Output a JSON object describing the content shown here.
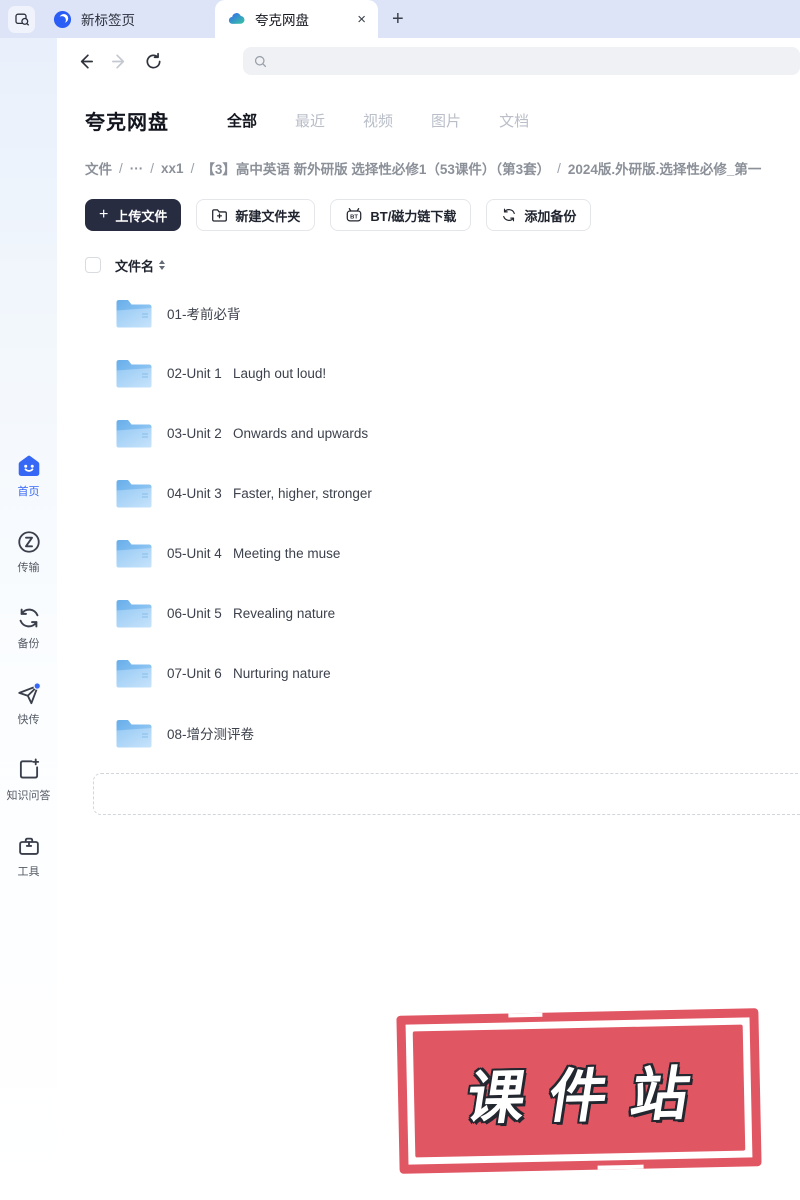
{
  "tabbar": {
    "tabs": [
      {
        "label": "新标签页"
      },
      {
        "label": "夸克网盘"
      }
    ],
    "close_glyph": "×",
    "new_tab_glyph": "+"
  },
  "page": {
    "title": "夸克网盘",
    "filter_tabs": [
      {
        "label": "全部",
        "active": true
      },
      {
        "label": "最近",
        "active": false
      },
      {
        "label": "视频",
        "active": false
      },
      {
        "label": "图片",
        "active": false
      },
      {
        "label": "文档",
        "active": false
      }
    ]
  },
  "breadcrumb": {
    "separator": "/",
    "items": [
      "文件",
      "···",
      "xx1",
      "【3】高中英语 新外研版 选择性必修1（53课件）（第3套）",
      "2024版.外研版.选择性必修_第一"
    ]
  },
  "toolbar": {
    "upload": "上传文件",
    "upload_plus": "+",
    "new_folder": "新建文件夹",
    "bt_download": "BT/磁力链下载",
    "add_backup": "添加备份"
  },
  "files": {
    "name_header": "文件名",
    "rows": [
      {
        "name": "01-考前必背"
      },
      {
        "name": "02-Unit 1   Laugh out loud!"
      },
      {
        "name": "03-Unit 2   Onwards and upwards"
      },
      {
        "name": "04-Unit 3   Faster, higher, stronger"
      },
      {
        "name": "05-Unit 4   Meeting the muse"
      },
      {
        "name": "06-Unit 5   Revealing nature"
      },
      {
        "name": "07-Unit 6   Nurturing nature"
      },
      {
        "name": "08-增分测评卷"
      }
    ]
  },
  "sidebar": {
    "items": [
      {
        "label": "首页",
        "active": true
      },
      {
        "label": "传输",
        "active": false
      },
      {
        "label": "备份",
        "active": false
      },
      {
        "label": "快传",
        "active": false
      },
      {
        "label": "知识问答",
        "active": false
      },
      {
        "label": "工具",
        "active": false
      }
    ]
  },
  "watermark": {
    "text": "课件站"
  },
  "colors": {
    "accent": "#3668f5",
    "stamp_red": "#e15663",
    "dark_button": "#272c40",
    "folder_blue": "#8ec6f3"
  }
}
